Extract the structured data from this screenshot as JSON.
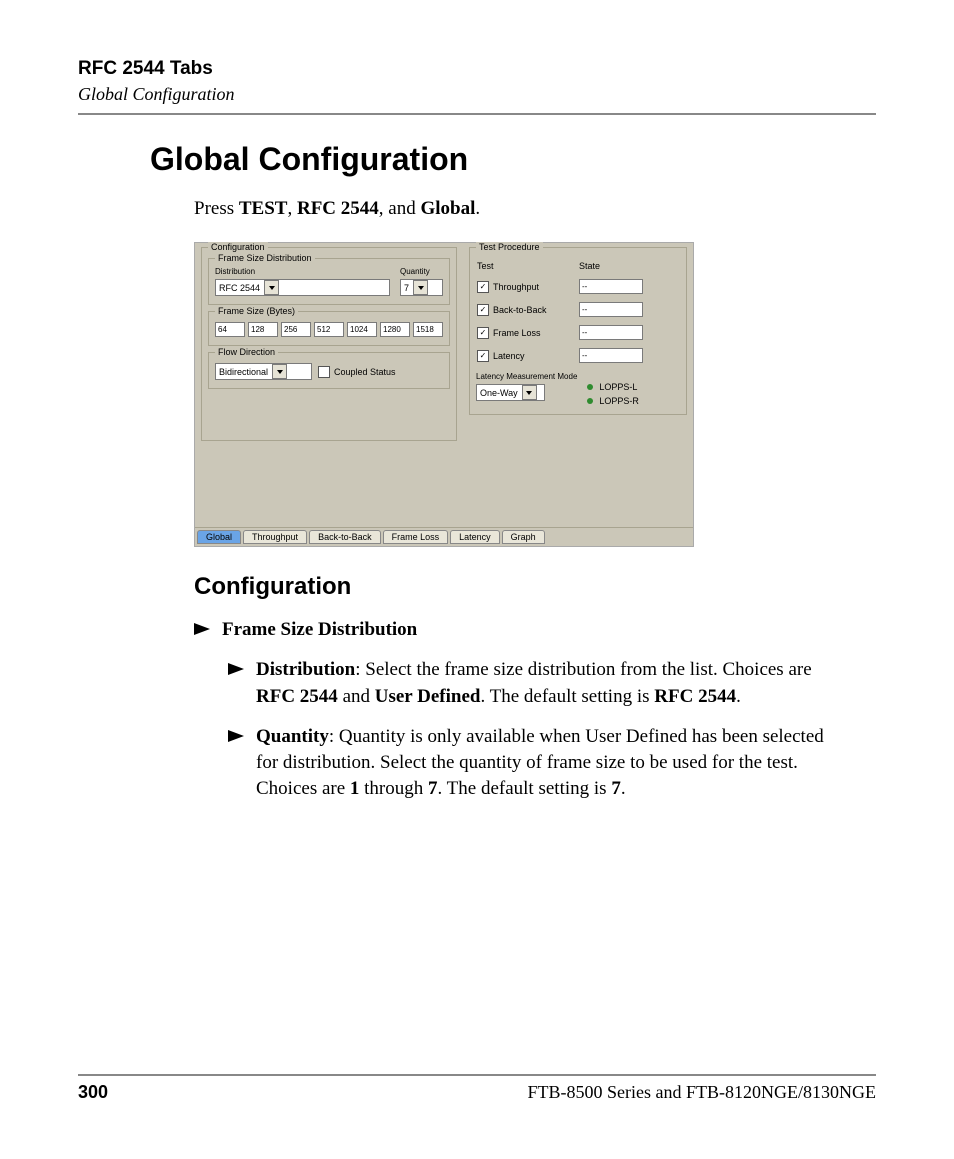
{
  "header": {
    "tabs_title": "RFC 2544 Tabs",
    "breadcrumb": "Global Configuration"
  },
  "title": "Global Configuration",
  "intro": {
    "prefix": "Press ",
    "k1": "TEST",
    "sep1": ", ",
    "k2": "RFC 2544",
    "sep2": ", and ",
    "k3": "Global",
    "suffix": "."
  },
  "section": {
    "config_title": "Configuration",
    "lvl1_frame_size": "Frame Size Distribution",
    "distribution": {
      "label": "Distribution",
      "text1": ": Select the frame size distribution from the list. Choices are ",
      "opt1": "RFC 2544",
      "and": " and ",
      "opt2": "User Defined",
      "text2": ". The default setting is ",
      "def": "RFC 2544",
      "end": "."
    },
    "quantity": {
      "label": "Quantity",
      "text1": ": Quantity is only available when User Defined has been selected for distribution. Select the quantity of frame size to be used for the test. Choices are ",
      "one": "1",
      "through": " through ",
      "seven": "7",
      "text2": ". The default setting is ",
      "def": "7",
      "end": "."
    }
  },
  "app": {
    "config": {
      "group": "Configuration",
      "fsd_group": "Frame Size Distribution",
      "dist_label": "Distribution",
      "dist_value": "RFC 2544",
      "qty_label": "Quantity",
      "qty_value": "7",
      "fsz_label": "Frame Size (Bytes)",
      "fsz_values": [
        "64",
        "128",
        "256",
        "512",
        "1024",
        "1280",
        "1518"
      ],
      "flow_group": "Flow Direction",
      "flow_value": "Bidirectional",
      "coupled": "Coupled Status"
    },
    "tests": {
      "group": "Test Procedure",
      "col_test": "Test",
      "col_state": "State",
      "rows": [
        {
          "name": "Throughput",
          "state": "--",
          "checked": true
        },
        {
          "name": "Back-to-Back",
          "state": "--",
          "checked": true
        },
        {
          "name": "Frame Loss",
          "state": "--",
          "checked": true
        },
        {
          "name": "Latency",
          "state": "--",
          "checked": true
        }
      ],
      "lat_mode_label": "Latency Measurement Mode",
      "lat_mode_value": "One-Way",
      "leds": [
        "LOPPS-L",
        "LOPPS-R"
      ]
    },
    "tabs": [
      "Global",
      "Throughput",
      "Back-to-Back",
      "Frame Loss",
      "Latency",
      "Graph"
    ]
  },
  "footer": {
    "page": "300",
    "product": "FTB-8500 Series and FTB-8120NGE/8130NGE"
  }
}
